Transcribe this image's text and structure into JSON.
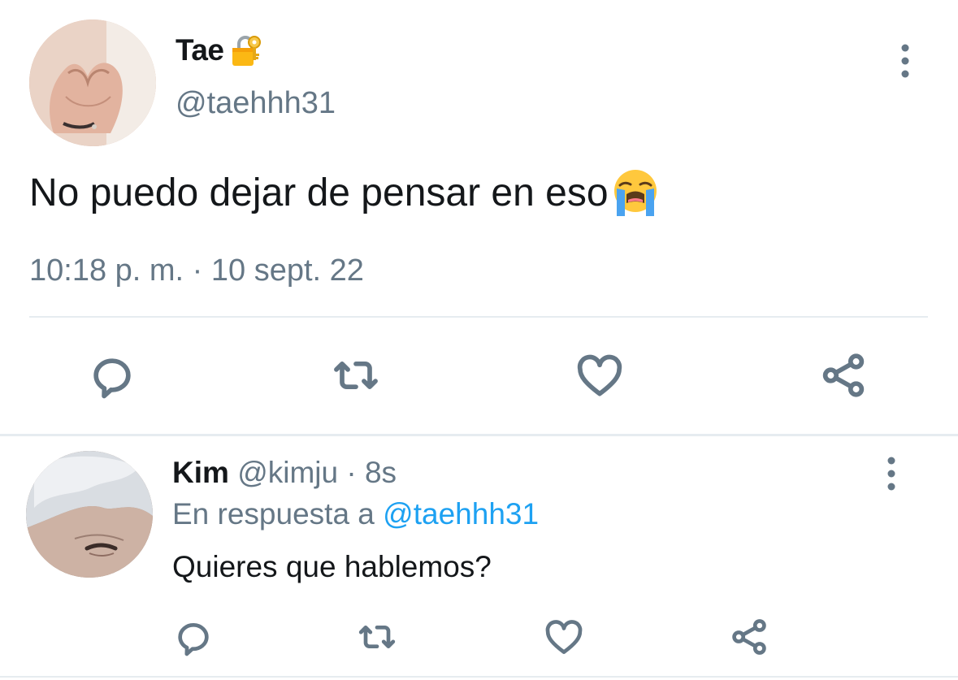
{
  "main_tweet": {
    "display_name": "Tae",
    "name_emoji": "locked-with-key-emoji",
    "handle": "@taehhh31",
    "text": "No puedo dejar de pensar en eso",
    "text_emoji": "loudly-crying-face-emoji",
    "timestamp": "10:18 p. m. · 10 sept. 22",
    "actions": [
      "reply-icon",
      "retweet-icon",
      "like-icon",
      "share-icon"
    ]
  },
  "reply_tweet": {
    "display_name": "Kim",
    "handle": "@kimju",
    "separator": "·",
    "age": "8s",
    "context_prefix": "En respuesta a",
    "context_mention": "@taehhh31",
    "text": "Quieres que hablemos?",
    "actions": [
      "reply-icon",
      "retweet-icon",
      "like-icon",
      "share-icon"
    ]
  },
  "colors": {
    "text": "#14171a",
    "secondary": "#657786",
    "link": "#1da1f2",
    "divider": "#e6ecf0"
  }
}
